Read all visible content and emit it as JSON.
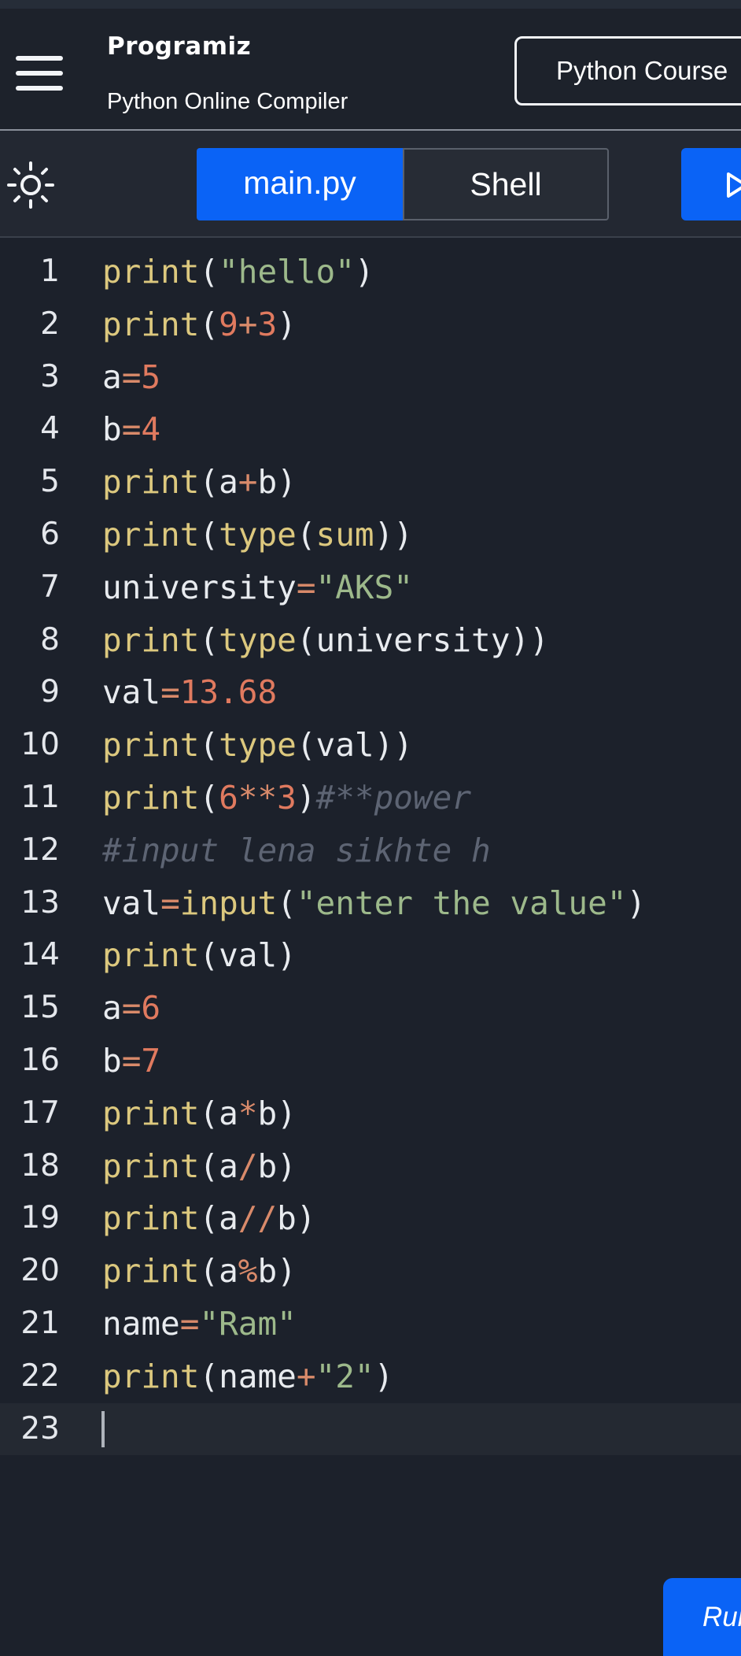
{
  "header": {
    "logo_text": "Programiz",
    "subtitle": "Python Online Compiler",
    "course_button": "Python Course"
  },
  "toolbar": {
    "tabs": [
      {
        "label": "main.py",
        "active": true
      },
      {
        "label": "Shell",
        "active": false
      }
    ],
    "theme_icon": "sun-icon",
    "run_icon": "play-icon"
  },
  "editor": {
    "current_line": 23,
    "lines": [
      {
        "n": "1",
        "code": "print(\"hello\")"
      },
      {
        "n": "2",
        "code": "print(9+3)"
      },
      {
        "n": "3",
        "code": "a=5"
      },
      {
        "n": "4",
        "code": "b=4"
      },
      {
        "n": "5",
        "code": "print(a+b)"
      },
      {
        "n": "6",
        "code": "print(type(sum))"
      },
      {
        "n": "7",
        "code": "university=\"AKS\""
      },
      {
        "n": "8",
        "code": "print(type(university))"
      },
      {
        "n": "9",
        "code": "val=13.68"
      },
      {
        "n": "10",
        "code": "print(type(val))"
      },
      {
        "n": "11",
        "code": "print(6**3)#**power"
      },
      {
        "n": "12",
        "code": "#input lena sikhte h"
      },
      {
        "n": "13",
        "code": "val=input(\"enter the value\")"
      },
      {
        "n": "14",
        "code": "print(val)"
      },
      {
        "n": "15",
        "code": "a=6"
      },
      {
        "n": "16",
        "code": "b=7"
      },
      {
        "n": "17",
        "code": "print(a*b)"
      },
      {
        "n": "18",
        "code": "print(a/b)"
      },
      {
        "n": "19",
        "code": "print(a//b)"
      },
      {
        "n": "20",
        "code": "print(a%b)"
      },
      {
        "n": "21",
        "code": "name=\"Ram\""
      },
      {
        "n": "22",
        "code": "print(name+\"2\")"
      },
      {
        "n": "23",
        "code": ""
      }
    ]
  },
  "run_button": "Run",
  "colors": {
    "accent": "#0a63f6",
    "background": "#1c212b",
    "function": "#dcc87e",
    "string": "#9db98b",
    "number": "#e07a5f",
    "comment": "#5d6473"
  }
}
